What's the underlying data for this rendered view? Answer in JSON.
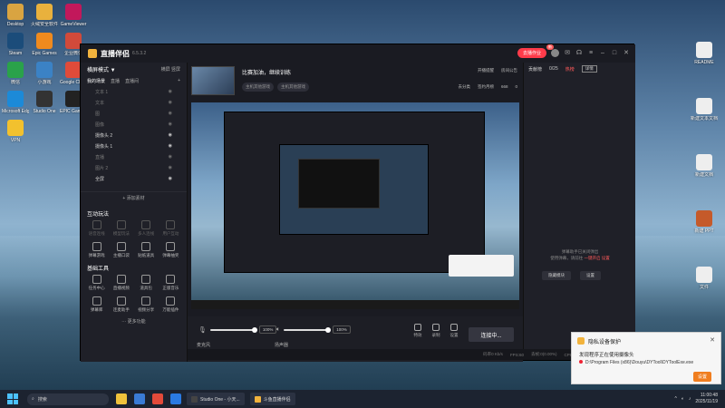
{
  "desktop_left": [
    {
      "label": "Desktop",
      "color": "#d9a441"
    },
    {
      "label": "火绒安全软件",
      "color": "#e9b13d"
    },
    {
      "label": "GameViewer",
      "color": "#c2185b"
    },
    {
      "label": "Steam",
      "color": "#1b4c7a"
    },
    {
      "label": "Epic Games",
      "color": "#f08a1e"
    },
    {
      "label": "企业微信",
      "color": "#d24a3a"
    },
    {
      "label": "微信",
      "color": "#2aa24a"
    },
    {
      "label": "小游戏",
      "color": "#3b82c5"
    },
    {
      "label": "Google Chrome",
      "color": "#e04b3a"
    },
    {
      "label": "Microsoft Edge",
      "color": "#1c8ad8"
    },
    {
      "label": "Studio One",
      "color": "#333"
    },
    {
      "label": "EPIC Games Launcher",
      "color": "#222"
    },
    {
      "label": "VPN",
      "color": "#f2c12e"
    }
  ],
  "desktop_right": [
    {
      "label": "README",
      "color": "#eee"
    },
    {
      "label": "新建文本文档",
      "color": "#eee"
    },
    {
      "label": "新建文档",
      "color": "#eee"
    },
    {
      "label": "新建 PPT",
      "color": "#c55a2a"
    },
    {
      "label": "文件",
      "color": "#eee"
    }
  ],
  "app": {
    "brand": "直播伴侣",
    "version": "6.5.3.2",
    "live_label": "去播作业",
    "live_badge": "新",
    "left": {
      "mode": "横屏模式 ▼",
      "opt1": "横屏",
      "opt2": "竖屏",
      "scene_header": "我的场景",
      "scene_tab1": "直播",
      "scene_tab2": "直播间",
      "add_scene": "+",
      "sources": [
        "文本 1",
        "文本",
        "图",
        "图像",
        "摄像头 2",
        "摄像头 1",
        "直播",
        "图片 2",
        "全屏"
      ],
      "add_source": "+ 添加素材",
      "interaction_title": "互动玩法",
      "interaction_tools": [
        "语音连线",
        "模型玩法",
        "多人连线",
        "用户互动",
        "弹幕游戏",
        "主播口袋",
        "贴纸道具",
        "弹幕抽奖"
      ],
      "basic_title": "基础工具",
      "basic_tools": [
        "任务中心",
        "直播视频",
        "道具包",
        "正版音乐",
        "弹幕库",
        "连麦助手",
        "视频分享",
        "万能插件"
      ],
      "more": "··· 更多功能"
    },
    "stream": {
      "title": "比赛加油，继续训练",
      "tag1": "主机其他游戏",
      "tag2": "主机其他游戏",
      "tag3": "去分类",
      "live_status": "开播提醒",
      "announce": "房间公告",
      "stat_like": "签约月榜",
      "stat_viewers": "668",
      "stat_count": "0"
    },
    "controls": {
      "mic_label": "麦克风",
      "mic_pct": "100%",
      "speaker_label": "扬声器",
      "speaker_pct": "100%",
      "btn1": "特效",
      "btn2": "录制",
      "btn3": "设置",
      "connect": "连接中..."
    },
    "status": [
      "码率0 Kb/s",
      "FPS:60",
      "丢帧:0(0.00%)",
      "CPU:23%",
      "内存:60%",
      "未开播"
    ],
    "right": {
      "h1": "贡献榜",
      "h2": "0/25",
      "h3": "热榜",
      "h4": "详情",
      "msg_line1": "弹幕助手已关闭弹出",
      "msg_line2": "使用弹幕，请前往",
      "msg_link": "一键开启",
      "msg_link2": "设置",
      "btn_a": "隐藏模块",
      "btn_b": "设置"
    }
  },
  "notification": {
    "title": "隐私设备保护",
    "subtitle": "发现程序正在使用摄像头",
    "path": "D:\\Program Files (x86)\\Douyu\\DYTool\\DYToolExe.exe",
    "button": "设置"
  },
  "taskbar": {
    "search": "搜索",
    "win1": "Studio One - 小天...",
    "win2": "斗鱼直播伴侣",
    "time": "11:00:48",
    "date": "2025/11/19"
  }
}
